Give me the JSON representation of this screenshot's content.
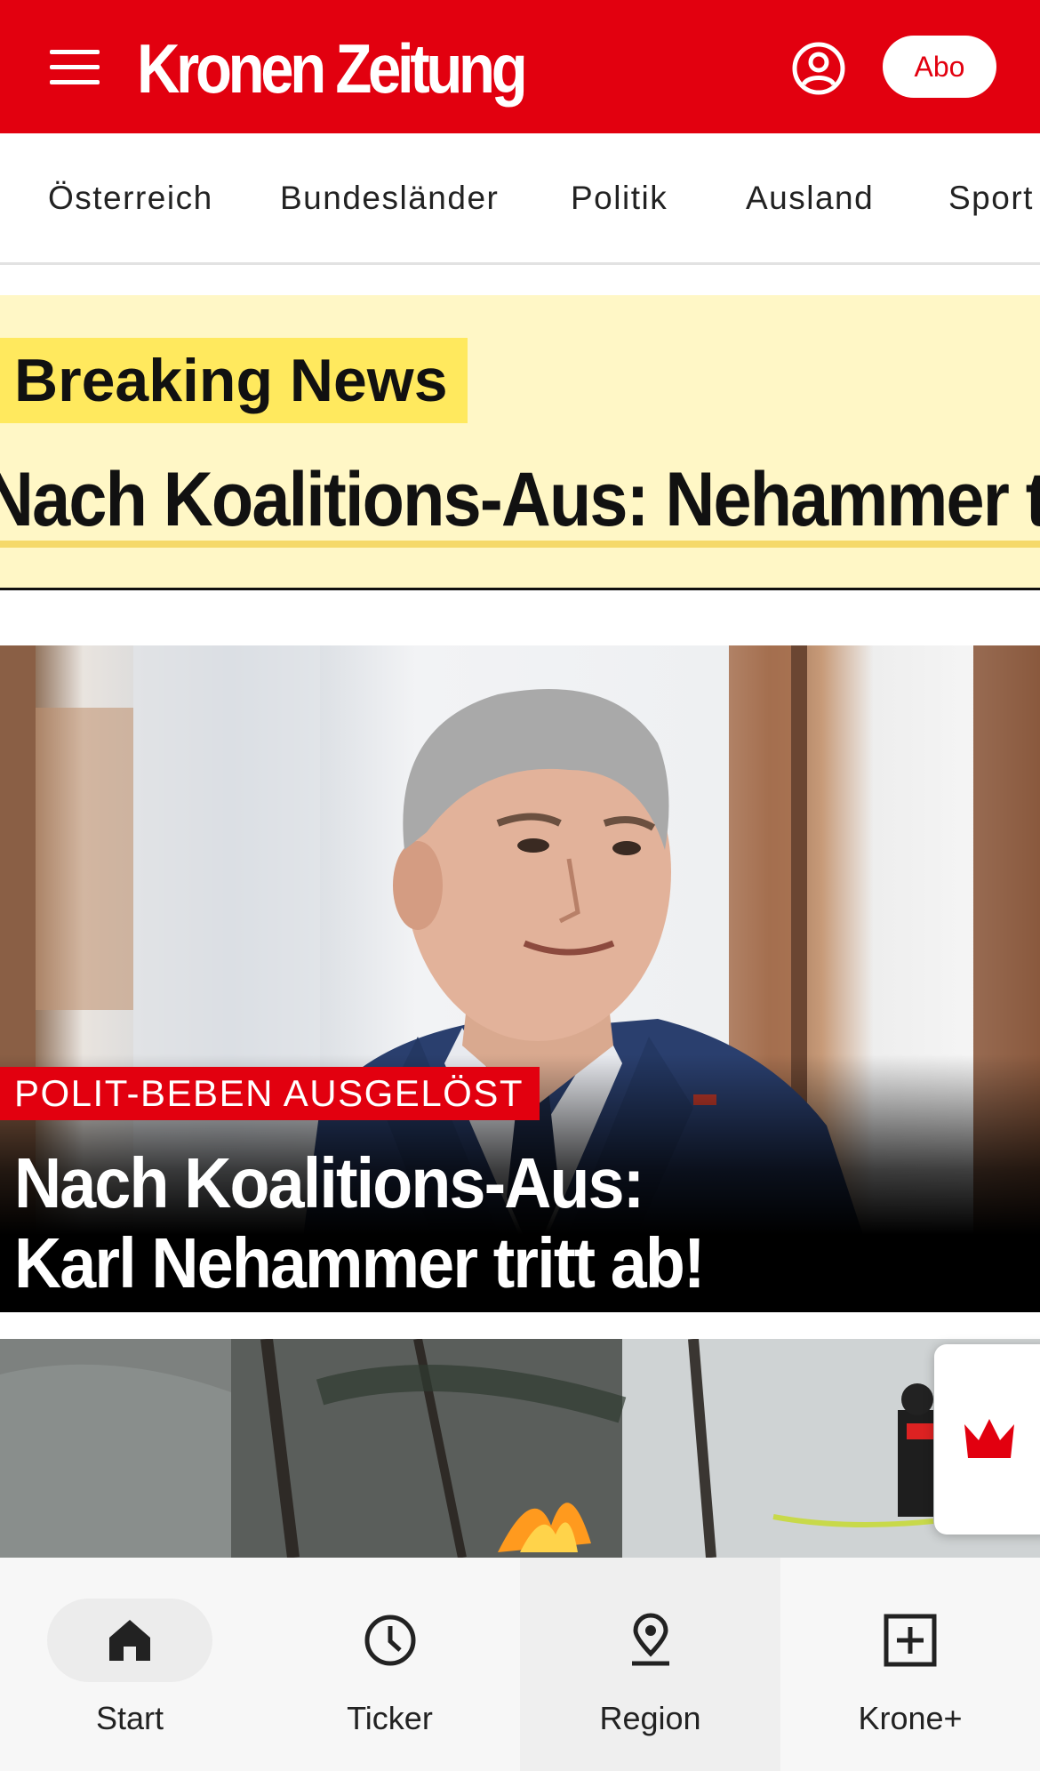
{
  "header": {
    "logo": "Kronen Zeitung",
    "abo_label": "Abo",
    "brand_color": "#e2000f"
  },
  "nav": {
    "items": [
      "Österreich",
      "Bundesländer",
      "Politik",
      "Ausland",
      "Sport"
    ]
  },
  "breaking": {
    "label": "Breaking News",
    "ticker": "Nach Koalitions-Aus: Nehammer tritt ab!"
  },
  "lead": {
    "kicker": "POLIT-BEBEN AUSGELÖST",
    "title_line1": "Nach Koalitions-Aus:",
    "title_line2": "Karl Nehammer tritt ab!"
  },
  "bottom_nav": {
    "items": [
      {
        "label": "Start",
        "icon": "home-icon",
        "active": true
      },
      {
        "label": "Ticker",
        "icon": "clock-icon",
        "active": false
      },
      {
        "label": "Region",
        "icon": "location-pin-icon",
        "active": false
      },
      {
        "label": "Krone+",
        "icon": "plus-square-icon",
        "active": false
      }
    ]
  }
}
